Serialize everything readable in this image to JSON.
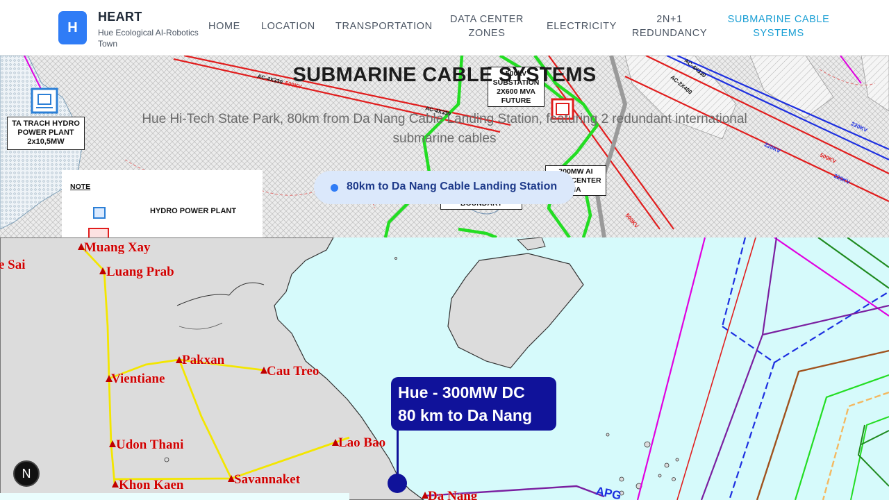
{
  "brand": {
    "logo_letter": "H",
    "name": "HEART",
    "subtitle": "Hue Ecological AI-Robotics Town"
  },
  "nav": {
    "items": [
      {
        "label": "HOME"
      },
      {
        "label": "LOCATION"
      },
      {
        "label": "TRANSPORTATION"
      },
      {
        "label": "DATA CENTER\nZONES"
      },
      {
        "label": "ELECTRICITY"
      },
      {
        "label": "2N+1\nREDUNDANCY"
      },
      {
        "label": "SUBMARINE CABLE\nSYSTEMS",
        "active": true
      }
    ]
  },
  "hero": {
    "title": "SUBMARINE CABLE SYSTEMS",
    "subtitle": "Hue Hi-Tech State Park, 80km from Da Nang Cable Landing Station, featuring 2 redundant international submarine cables",
    "badge": "80km to Da Nang Cable Landing Station"
  },
  "bg_map": {
    "hydro_label": "TA TRACH HYDRO\nPOWER PLANT\n2x10,5MW",
    "substation_label": "500kV\nSUBSTATION\n2X600 MVA\nFUTURE",
    "dc_label": "300MW AI\nDATA CENTER\nHA",
    "boundary_label": "BOUNDARY",
    "note_title": "NOTE",
    "note_item": "HYDRO POWER PLANT",
    "line_labels": [
      "AC-4X330",
      "500KV",
      "AC-4X330",
      "220KV",
      "AC-2X400",
      "AC-4X330",
      "500KV",
      "220KV",
      "500KV",
      "220KV"
    ]
  },
  "map": {
    "cities": [
      "Muang Xay",
      "Luang Prab",
      "e Sai",
      "Pakxan",
      "Vientiane",
      "Cau Treo",
      "Udon Thani",
      "Lao Bao",
      "Khon Kaen",
      "Savannaket",
      "Da Nang"
    ],
    "cable_label": "APG",
    "callout_line1": "Hue - 300MW DC",
    "callout_line2": "80 km to Da Nang"
  },
  "colors": {
    "accent": "#2f7cf6",
    "nav_active": "#1a9fd4",
    "callout": "#10129a",
    "sea": "#d6fafb",
    "land": "#dcdcdc"
  },
  "badge_letter": "N"
}
